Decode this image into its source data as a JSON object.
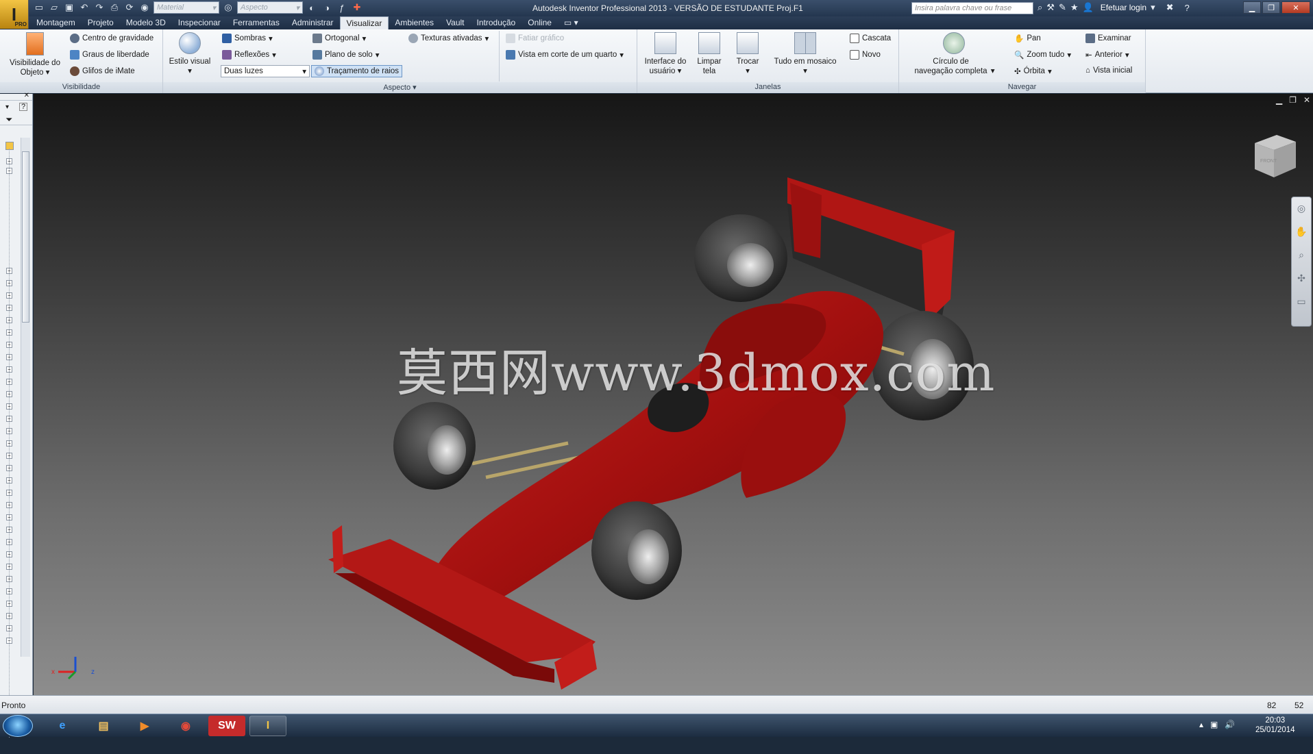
{
  "titlebar": {
    "title": "Autodesk Inventor Professional 2013 - VERSÃO DE ESTUDANTE   Proj.F1",
    "logo_badge": "PRO",
    "material_combo": "Material",
    "appearance_combo": "Aspecto",
    "search_placeholder": "Insira palavra chave ou frase",
    "login_label": "Efetuar login"
  },
  "tabs": [
    "Montagem",
    "Projeto",
    "Modelo 3D",
    "Inspecionar",
    "Ferramentas",
    "Administrar",
    "Visualizar",
    "Ambientes",
    "Vault",
    "Introdução",
    "Online"
  ],
  "active_tab": "Visualizar",
  "ribbon": {
    "visibility": {
      "title": "Visibilidade",
      "object_visibility": "Visibilidade do Objeto",
      "center_of_gravity": "Centro de gravidade",
      "degrees_of_freedom": "Graus de liberdade",
      "imate_glyphs": "Glifos de iMate"
    },
    "appearance": {
      "title": "Aspecto",
      "visual_style": "Estilo visual",
      "shadows": "Sombras",
      "reflections": "Reflexões",
      "lighting_value": "Duas luzes",
      "orthographic": "Ortogonal",
      "ground_plane": "Plano de solo",
      "ray_tracing": "Traçamento de raios",
      "textures_on": "Texturas ativadas",
      "slice_graphics": "Fatiar gráfico",
      "quarter_section": "Vista em corte de um quarto"
    },
    "windows": {
      "title": "Janelas",
      "user_interface": "Interface do usuário",
      "clean_screen": "Limpar tela",
      "switch": "Trocar",
      "tile_all": "Tudo em mosaico",
      "cascade": "Cascata",
      "new": "Novo"
    },
    "navigate": {
      "title": "Navegar",
      "full_navigation_wheel": "Círculo de navegação completa",
      "pan": "Pan",
      "zoom_all": "Zoom tudo",
      "orbit": "Órbita",
      "look_at": "Examinar",
      "previous": "Anterior",
      "home_view": "Vista inicial"
    }
  },
  "viewport": {
    "watermark": "莫西网www.3dmox.com",
    "viewcube_face": "FRONT"
  },
  "statusbar": {
    "status": "Pronto",
    "count_1": "82",
    "count_2": "52"
  },
  "taskbar": {
    "time": "20:03",
    "date": "25/01/2014"
  },
  "colors": {
    "car_body": "#a3100f",
    "accent": "#2c3e57"
  }
}
